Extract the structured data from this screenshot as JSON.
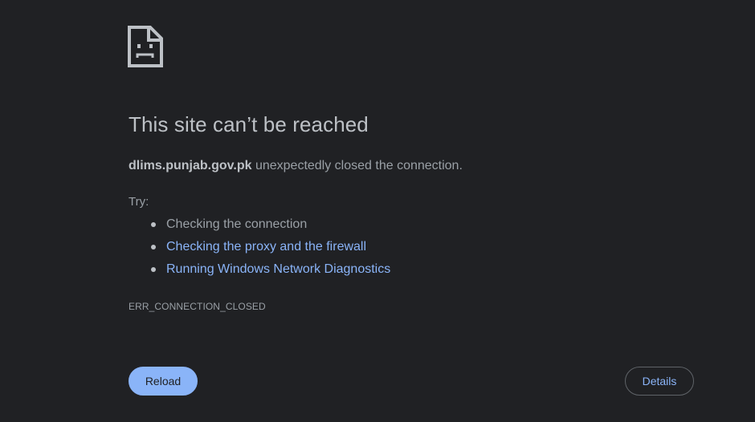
{
  "error_page": {
    "icon": "sad-page-icon",
    "title": "This site can’t be reached",
    "summary": {
      "domain": "dlims.punjab.gov.pk",
      "message": " unexpectedly closed the connection."
    },
    "try_label": "Try:",
    "suggestions": [
      {
        "label": "Checking the connection",
        "is_link": false
      },
      {
        "label": "Checking the proxy and the firewall",
        "is_link": true
      },
      {
        "label": "Running Windows Network Diagnostics",
        "is_link": true
      }
    ],
    "error_code": "ERR_CONNECTION_CLOSED",
    "buttons": {
      "reload_label": "Reload",
      "details_label": "Details"
    }
  },
  "colors": {
    "background": "#202124",
    "text": "#9aa0a6",
    "heading": "#bdc1c6",
    "link": "#8ab4f8"
  }
}
